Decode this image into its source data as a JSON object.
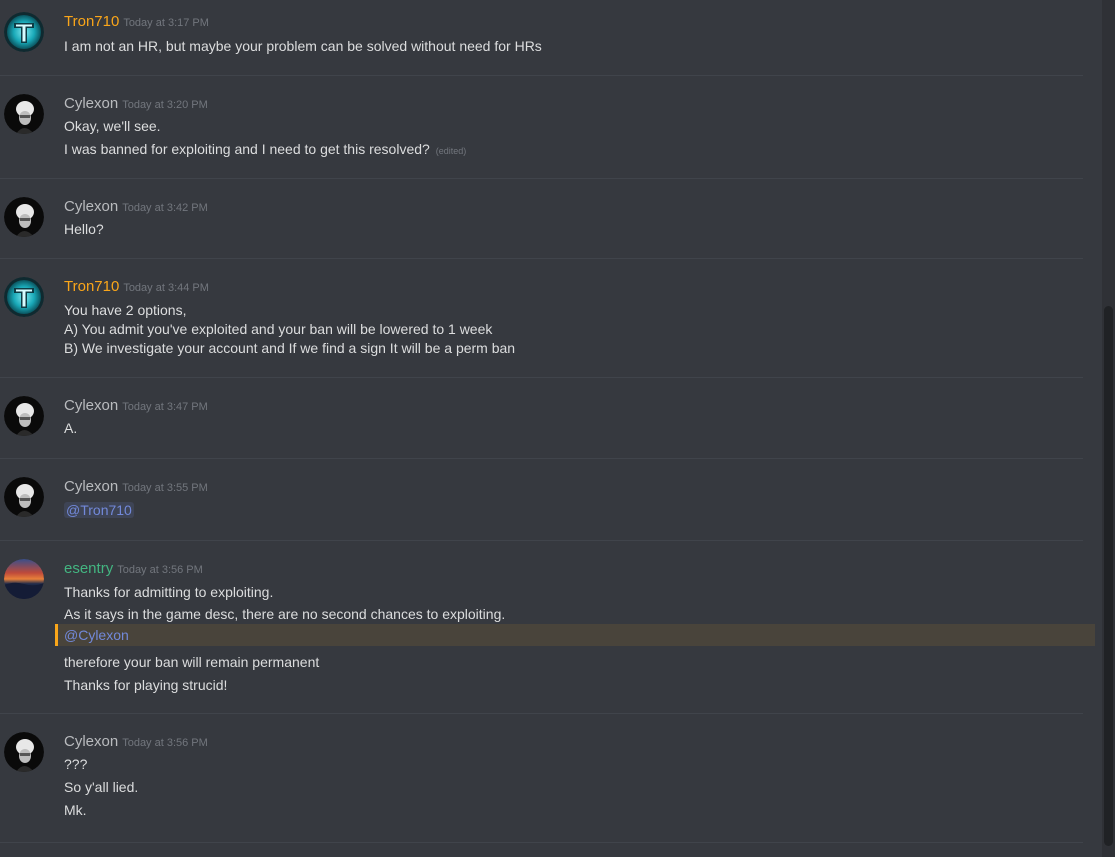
{
  "colors": {
    "background": "#36393f",
    "tron_name": "#faa61a",
    "cylexon_name": "#b9bbbe",
    "esentry_name": "#43b581",
    "mention": "#7289da",
    "mention_highlight_border": "#faa61a"
  },
  "messages": [
    {
      "author": "Tron710",
      "timestamp": "Today at 3:17 PM",
      "avatar_icon": "tron-avatar-icon",
      "lines": [
        "I am not an HR, but maybe your problem can be solved without need for HRs"
      ]
    },
    {
      "author": "Cylexon",
      "timestamp": "Today at 3:20 PM",
      "avatar_icon": "cylexon-avatar-icon",
      "lines": [
        "Okay, we'll see.",
        "I was banned for exploiting and I need to get this resolved?"
      ],
      "edited_label": "(edited)"
    },
    {
      "author": "Cylexon",
      "timestamp": "Today at 3:42 PM",
      "avatar_icon": "cylexon-avatar-icon",
      "lines": [
        "Hello?"
      ]
    },
    {
      "author": "Tron710",
      "timestamp": "Today at 3:44 PM",
      "avatar_icon": "tron-avatar-icon",
      "lines": [
        "You have 2 options,",
        "A) You admit you've exploited and your ban will be lowered to 1 week",
        "B) We investigate your account and If we find a sign It will be a perm ban"
      ]
    },
    {
      "author": "Cylexon",
      "timestamp": "Today at 3:47 PM",
      "avatar_icon": "cylexon-avatar-icon",
      "lines": [
        "A."
      ]
    },
    {
      "author": "Cylexon",
      "timestamp": "Today at 3:55 PM",
      "avatar_icon": "cylexon-avatar-icon",
      "mention": "@Tron710"
    },
    {
      "author": "esentry",
      "timestamp": "Today at 3:56 PM",
      "avatar_icon": "esentry-avatar-icon",
      "lines": [
        "Thanks for admitting to exploiting.",
        "As it says in the game desc, there are no second chances to exploiting."
      ],
      "mention": "@Cylexon",
      "lines_after": [
        "therefore your ban will remain permanent",
        "Thanks for playing strucid!"
      ]
    },
    {
      "author": "Cylexon",
      "timestamp": "Today at 3:56 PM",
      "avatar_icon": "cylexon-avatar-icon",
      "lines": [
        "???",
        "So y'all lied.",
        "Mk."
      ]
    }
  ]
}
